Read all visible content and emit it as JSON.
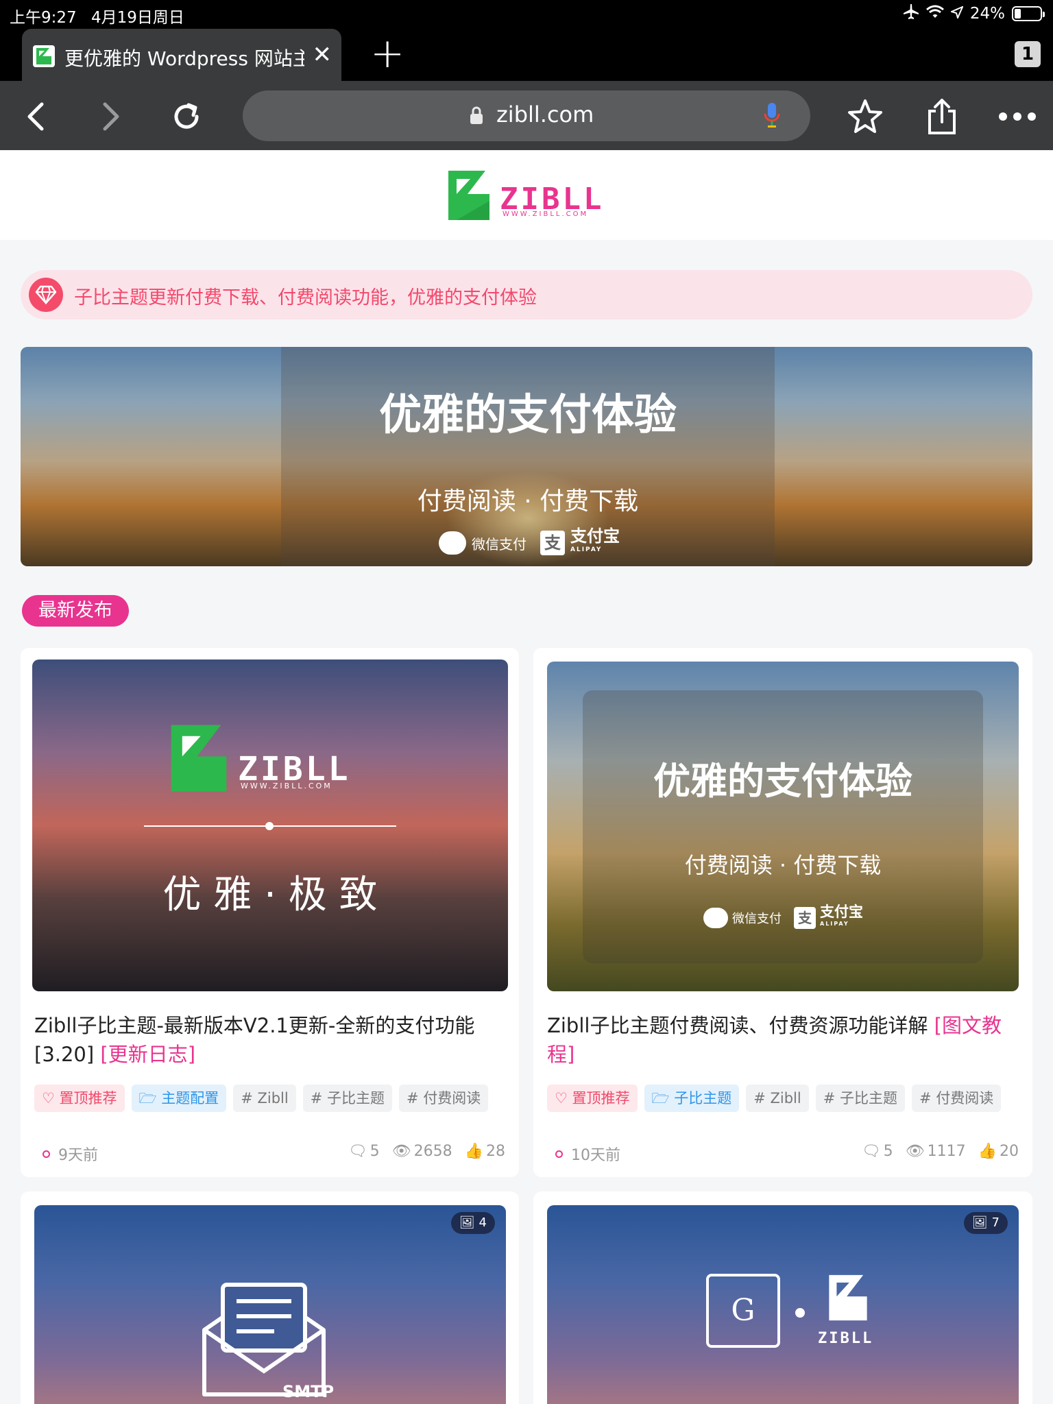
{
  "status_bar": {
    "time": "上午9:27",
    "date": "4月19日周日",
    "battery": "24%",
    "battery_level": 0.24
  },
  "browser": {
    "tab_title": "更优雅的 Wordpress 网站主题",
    "tab_count": "1",
    "url": "zibll.com"
  },
  "site": {
    "logo_text": "ZIBLL",
    "logo_sub": "WWW.ZIBLL.COM"
  },
  "notice": {
    "text": "子比主题更新付费下载、付费阅读功能，优雅的支付体验"
  },
  "banner": {
    "title": "优雅的支付体验",
    "subtitle": "付费阅读 · 付费下载",
    "wechat": "微信支付",
    "alipay": "支付宝",
    "alipay_en": "ALIPAY"
  },
  "section_label": "最新发布",
  "posts": [
    {
      "thumb_logo": "ZIBLL",
      "thumb_sub": "WWW.ZIBLL.COM",
      "thumb_text": "优 雅 · 极 致",
      "title": "Zibll子比主题-最新版本V2.1更新-全新的支付功能[3.20]",
      "title_accent": "[更新日志]",
      "tags": [
        "置顶推荐",
        "主题配置",
        "# Zibll",
        "# 子比主题",
        "# 付费阅读"
      ],
      "time": "9天前",
      "comments": "5",
      "views": "2658",
      "likes": "28"
    },
    {
      "thumb_title": "优雅的支付体验",
      "thumb_subtitle": "付费阅读 · 付费下载",
      "thumb_wechat": "微信支付",
      "thumb_alipay": "支付宝",
      "thumb_alipay_en": "ALIPAY",
      "title": "Zibll子比主题付费阅读、付费资源功能详解",
      "title_accent": "[图文教程]",
      "tags": [
        "置顶推荐",
        "子比主题",
        "# Zibll",
        "# 子比主题",
        "# 付费阅读"
      ],
      "time": "10天前",
      "comments": "5",
      "views": "1117",
      "likes": "20"
    },
    {
      "image_count": "4",
      "thumb_text": "SMTP"
    },
    {
      "image_count": "7",
      "thumb_text": "ZIBLL",
      "thumb_letter": "G"
    }
  ]
}
